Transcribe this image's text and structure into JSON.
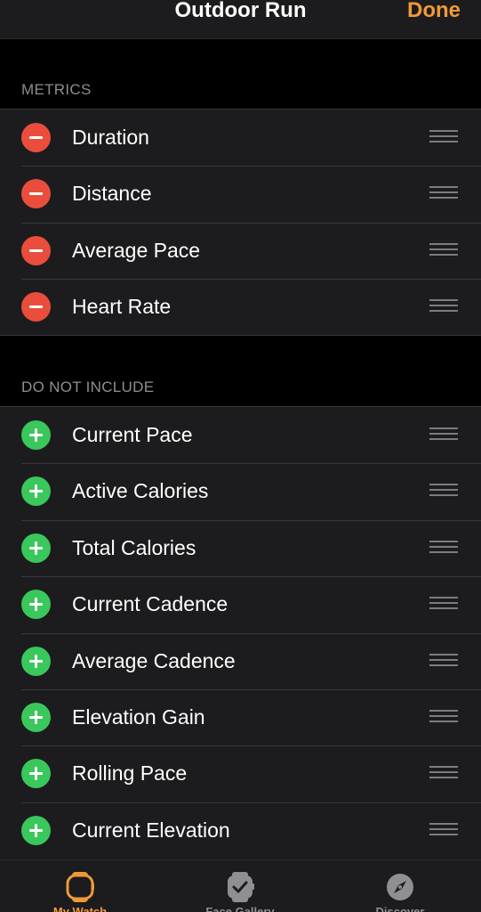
{
  "navbar": {
    "title": "Outdoor Run",
    "done_label": "Done"
  },
  "sections": {
    "metrics_header": "METRICS",
    "exclude_header": "DO NOT INCLUDE"
  },
  "metrics": [
    {
      "label": "Duration"
    },
    {
      "label": "Distance"
    },
    {
      "label": "Average Pace"
    },
    {
      "label": "Heart Rate"
    }
  ],
  "excluded": [
    {
      "label": "Current Pace"
    },
    {
      "label": "Active Calories"
    },
    {
      "label": "Total Calories"
    },
    {
      "label": "Current Cadence"
    },
    {
      "label": "Average Cadence"
    },
    {
      "label": "Elevation Gain"
    },
    {
      "label": "Rolling Pace"
    },
    {
      "label": "Current Elevation"
    }
  ],
  "tabbar": {
    "tabs": [
      {
        "label": "My Watch",
        "icon": "watch-icon",
        "active": true
      },
      {
        "label": "Face Gallery",
        "icon": "watch-face-icon",
        "active": false
      },
      {
        "label": "Discover",
        "icon": "compass-icon",
        "active": false
      }
    ]
  },
  "colors": {
    "accent": "#f09a37",
    "remove": "#eb4d3d",
    "add": "#3ac75b",
    "background": "#000000",
    "cell": "#1c1c1e",
    "header_text": "#8e8e93",
    "inactive_tab": "#8e8e93"
  }
}
